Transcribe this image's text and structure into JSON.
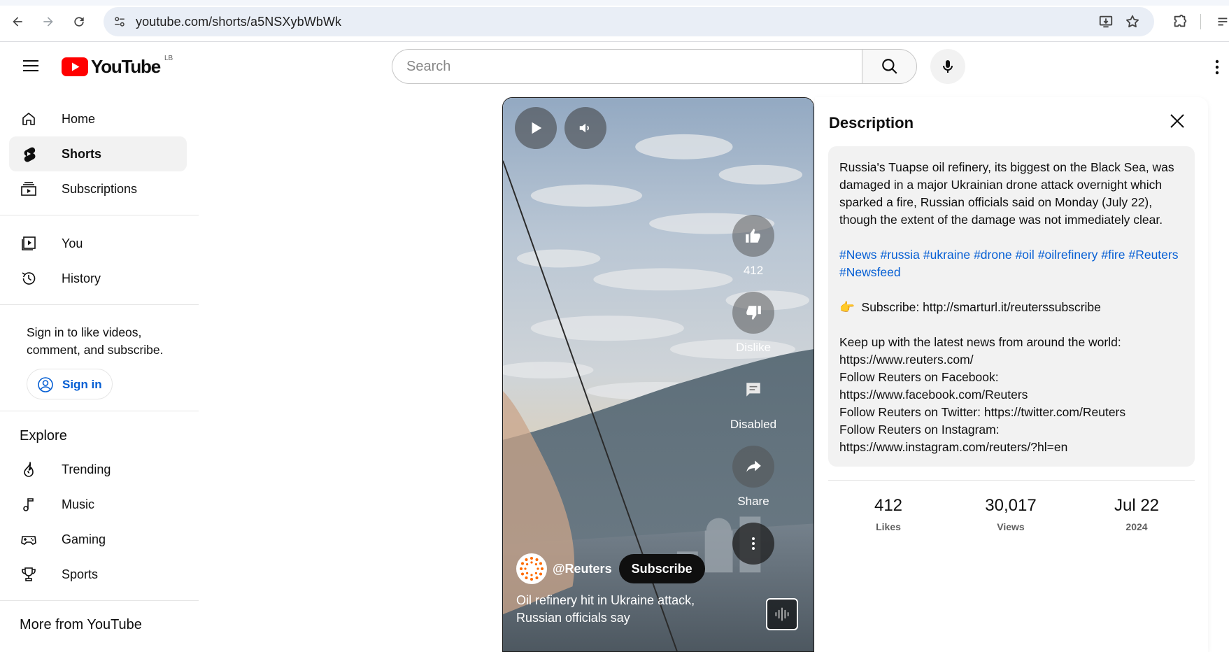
{
  "browser": {
    "url": "youtube.com/shorts/a5NSXybWbWk"
  },
  "header": {
    "logo_text": "YouTube",
    "country_code": "LB",
    "search_placeholder": "Search"
  },
  "sidebar": {
    "primary": [
      {
        "label": "Home",
        "icon": "home-icon"
      },
      {
        "label": "Shorts",
        "icon": "shorts-icon",
        "active": true
      },
      {
        "label": "Subscriptions",
        "icon": "subscriptions-icon"
      }
    ],
    "you": [
      {
        "label": "You",
        "icon": "you-icon"
      },
      {
        "label": "History",
        "icon": "history-icon"
      }
    ],
    "signin_prompt": "Sign in to like videos, comment, and subscribe.",
    "signin_label": "Sign in",
    "explore_title": "Explore",
    "explore": [
      {
        "label": "Trending",
        "icon": "trending-icon"
      },
      {
        "label": "Music",
        "icon": "music-icon"
      },
      {
        "label": "Gaming",
        "icon": "gaming-icon"
      },
      {
        "label": "Sports",
        "icon": "sports-icon"
      }
    ],
    "more_title": "More from YouTube"
  },
  "video": {
    "channel_handle": "@Reuters",
    "subscribe_label": "Subscribe",
    "title": "Oil refinery hit in Ukraine attack, Russian officials say",
    "actions": {
      "like_count": "412",
      "dislike_label": "Dislike",
      "comments_label": "Disabled",
      "share_label": "Share"
    }
  },
  "description": {
    "title": "Description",
    "summary": "Russia's Tuapse oil refinery, its biggest on the Black Sea, was damaged in a major Ukrainian drone attack overnight which sparked a fire, Russian officials said on Monday (July 22), though the extent of the damage was not immediately clear.",
    "hashtags": [
      "#News",
      "#russia",
      "#ukraine",
      "#drone",
      "#oil",
      "#oilrefinery",
      "#fire",
      "#Reuters",
      "#Newsfeed"
    ],
    "subscribe_emoji": "👉",
    "subscribe_line": "Subscribe: http://smarturl.it/reuterssubscribe",
    "lines": [
      "Keep up with the latest news from around the world:",
      "https://www.reuters.com/",
      "Follow Reuters on Facebook:",
      "https://www.facebook.com/Reuters",
      "Follow Reuters on Twitter: https://twitter.com/Reuters",
      "Follow Reuters on Instagram:",
      "https://www.instagram.com/reuters/?hl=en"
    ],
    "stats": [
      {
        "value": "412",
        "label": "Likes"
      },
      {
        "value": "30,017",
        "label": "Views"
      },
      {
        "value": "Jul 22",
        "label": "2024"
      }
    ]
  },
  "colors": {
    "brand_red": "#ff0000",
    "link_blue": "#065fd4",
    "active_bg": "#f2f2f2"
  }
}
